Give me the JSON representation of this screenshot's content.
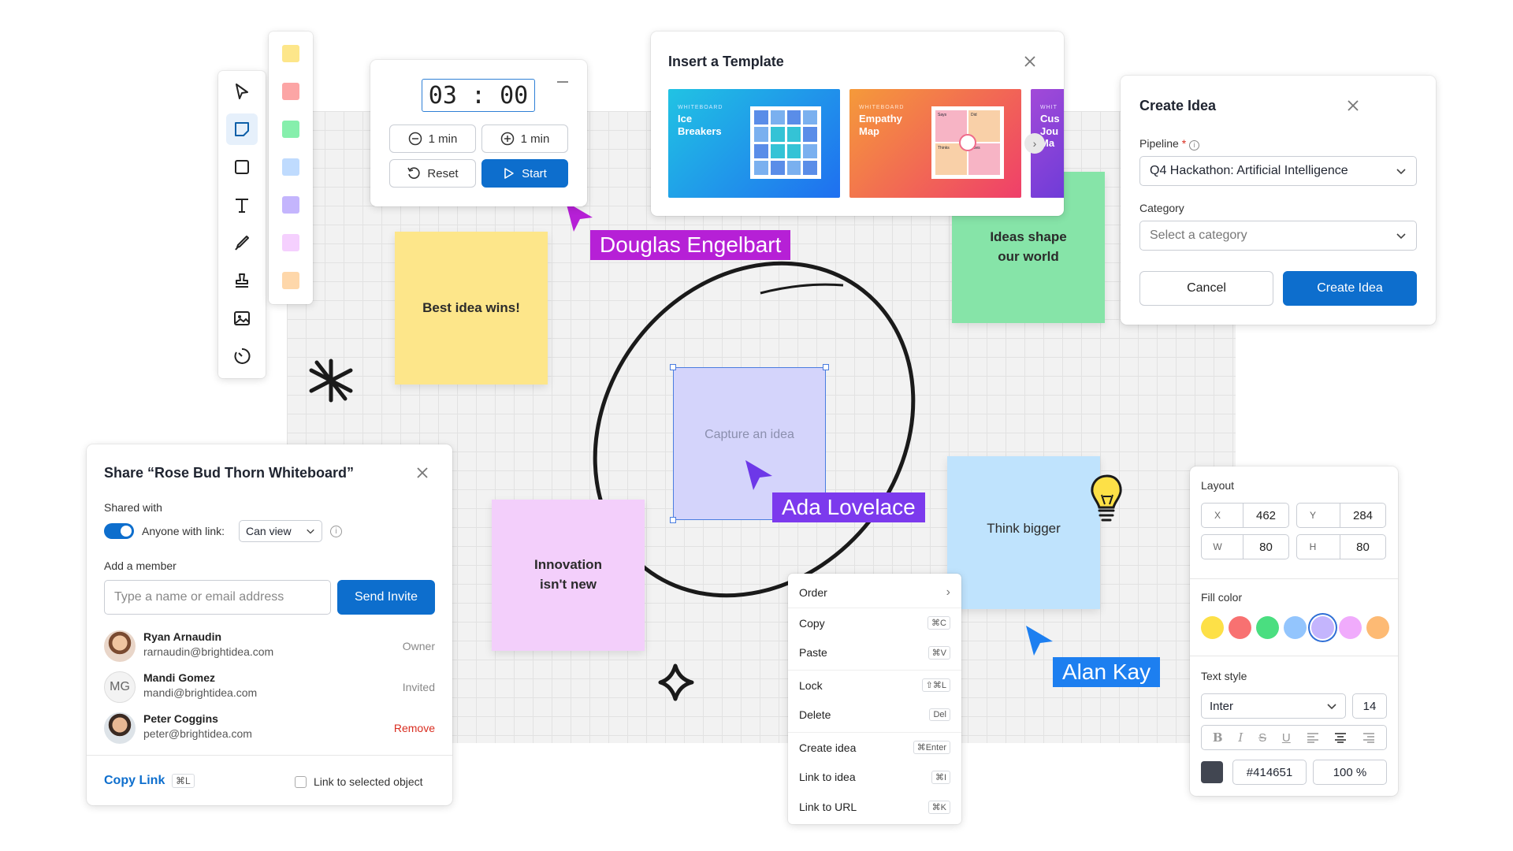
{
  "toolbar": {
    "tools": [
      "select-icon",
      "sticky-note-icon",
      "rectangle-icon",
      "text-icon",
      "pen-icon",
      "stamp-icon",
      "image-icon",
      "timer-icon"
    ]
  },
  "sticky_palette": {
    "colors": [
      "#fde68a",
      "#fca5a5",
      "#86efac",
      "#bfdbfe",
      "#c4b5fd",
      "#f5d0fe",
      "#fed7aa"
    ]
  },
  "timer": {
    "display": "03 : 00",
    "minus_label": "1 min",
    "plus_label": "1 min",
    "reset_label": "Reset",
    "start_label": "Start"
  },
  "template_dialog": {
    "title": "Insert a Template",
    "cards": [
      {
        "kicker": "WHITEBOARD",
        "name_l1": "Ice",
        "name_l2": "Breakers"
      },
      {
        "kicker": "WHITEBOARD",
        "name_l1": "Empathy",
        "name_l2": "Map"
      },
      {
        "kicker": "WHIT",
        "name_l1": "Cus",
        "name_l2": "Jou",
        "name_l3": "Ma"
      }
    ],
    "mini_labels": [
      "Says",
      "Did",
      "Thinks",
      "Does"
    ]
  },
  "create_idea": {
    "title": "Create Idea",
    "pipeline_label": "Pipeline",
    "required_mark": "*",
    "pipeline_value": "Q4 Hackathon: Artificial Intelligence",
    "category_label": "Category",
    "category_placeholder": "Select a category",
    "cancel_label": "Cancel",
    "submit_label": "Create Idea"
  },
  "notes": {
    "yellow": "Best idea wins!",
    "green_l1": "Ideas shape",
    "green_l2": "our world",
    "purple": "Capture an idea",
    "pink_l1": "Innovation",
    "pink_l2": "isn't new",
    "blue": "Think bigger"
  },
  "cursors": {
    "douglas": {
      "name": "Douglas Engelbart",
      "color": "#b620d6"
    },
    "ada": {
      "name": "Ada Lovelace",
      "color": "#7c3aed"
    },
    "alan": {
      "name": "Alan Kay",
      "color": "#1d7ff0"
    }
  },
  "context_menu": {
    "items": [
      {
        "label": "Order",
        "shortcut": "›"
      },
      {
        "label": "Copy",
        "shortcut": "⌘C"
      },
      {
        "label": "Paste",
        "shortcut": "⌘V"
      },
      {
        "label": "Lock",
        "shortcut": "⇧⌘L"
      },
      {
        "label": "Delete",
        "shortcut": "Del"
      },
      {
        "label": "Create idea",
        "shortcut": "⌘Enter"
      },
      {
        "label": "Link to idea",
        "shortcut": "⌘I"
      },
      {
        "label": "Link to URL",
        "shortcut": "⌘K"
      }
    ]
  },
  "properties": {
    "layout_title": "Layout",
    "x_label": "X",
    "x_value": "462",
    "y_label": "Y",
    "y_value": "284",
    "w_label": "W",
    "w_value": "80",
    "h_label": "H",
    "h_value": "80",
    "fill_title": "Fill color",
    "fill_colors": [
      "#fde047",
      "#f87171",
      "#4ade80",
      "#93c5fd",
      "#c4b5fd",
      "#f0abfc",
      "#fdba74"
    ],
    "selected_fill": "#c4b5fd",
    "text_style_title": "Text style",
    "font_value": "Inter",
    "font_size": "14",
    "text_color": "#414651",
    "opacity": "100 %"
  },
  "share": {
    "title": "Share “Rose Bud Thorn Whiteboard”",
    "shared_with_label": "Shared with",
    "anyone_label": "Anyone with link:",
    "permission_value": "Can view",
    "add_member_label": "Add a member",
    "input_placeholder": "Type a name or email address",
    "send_label": "Send Invite",
    "members": [
      {
        "name": "Ryan Arnaudin",
        "email": "rarnaudin@brightidea.com",
        "status": "Owner"
      },
      {
        "name": "Mandi Gomez",
        "email": "mandi@brightidea.com",
        "status": "Invited",
        "initials": "MG"
      },
      {
        "name": "Peter Coggins",
        "email": "peter@brightidea.com",
        "status": "Remove"
      }
    ],
    "copy_link_label": "Copy Link",
    "copy_link_shortcut": "⌘L",
    "link_selected_label": "Link to selected object"
  },
  "colors": {
    "accent": "#0d6ecd",
    "danger": "#d92d20"
  }
}
